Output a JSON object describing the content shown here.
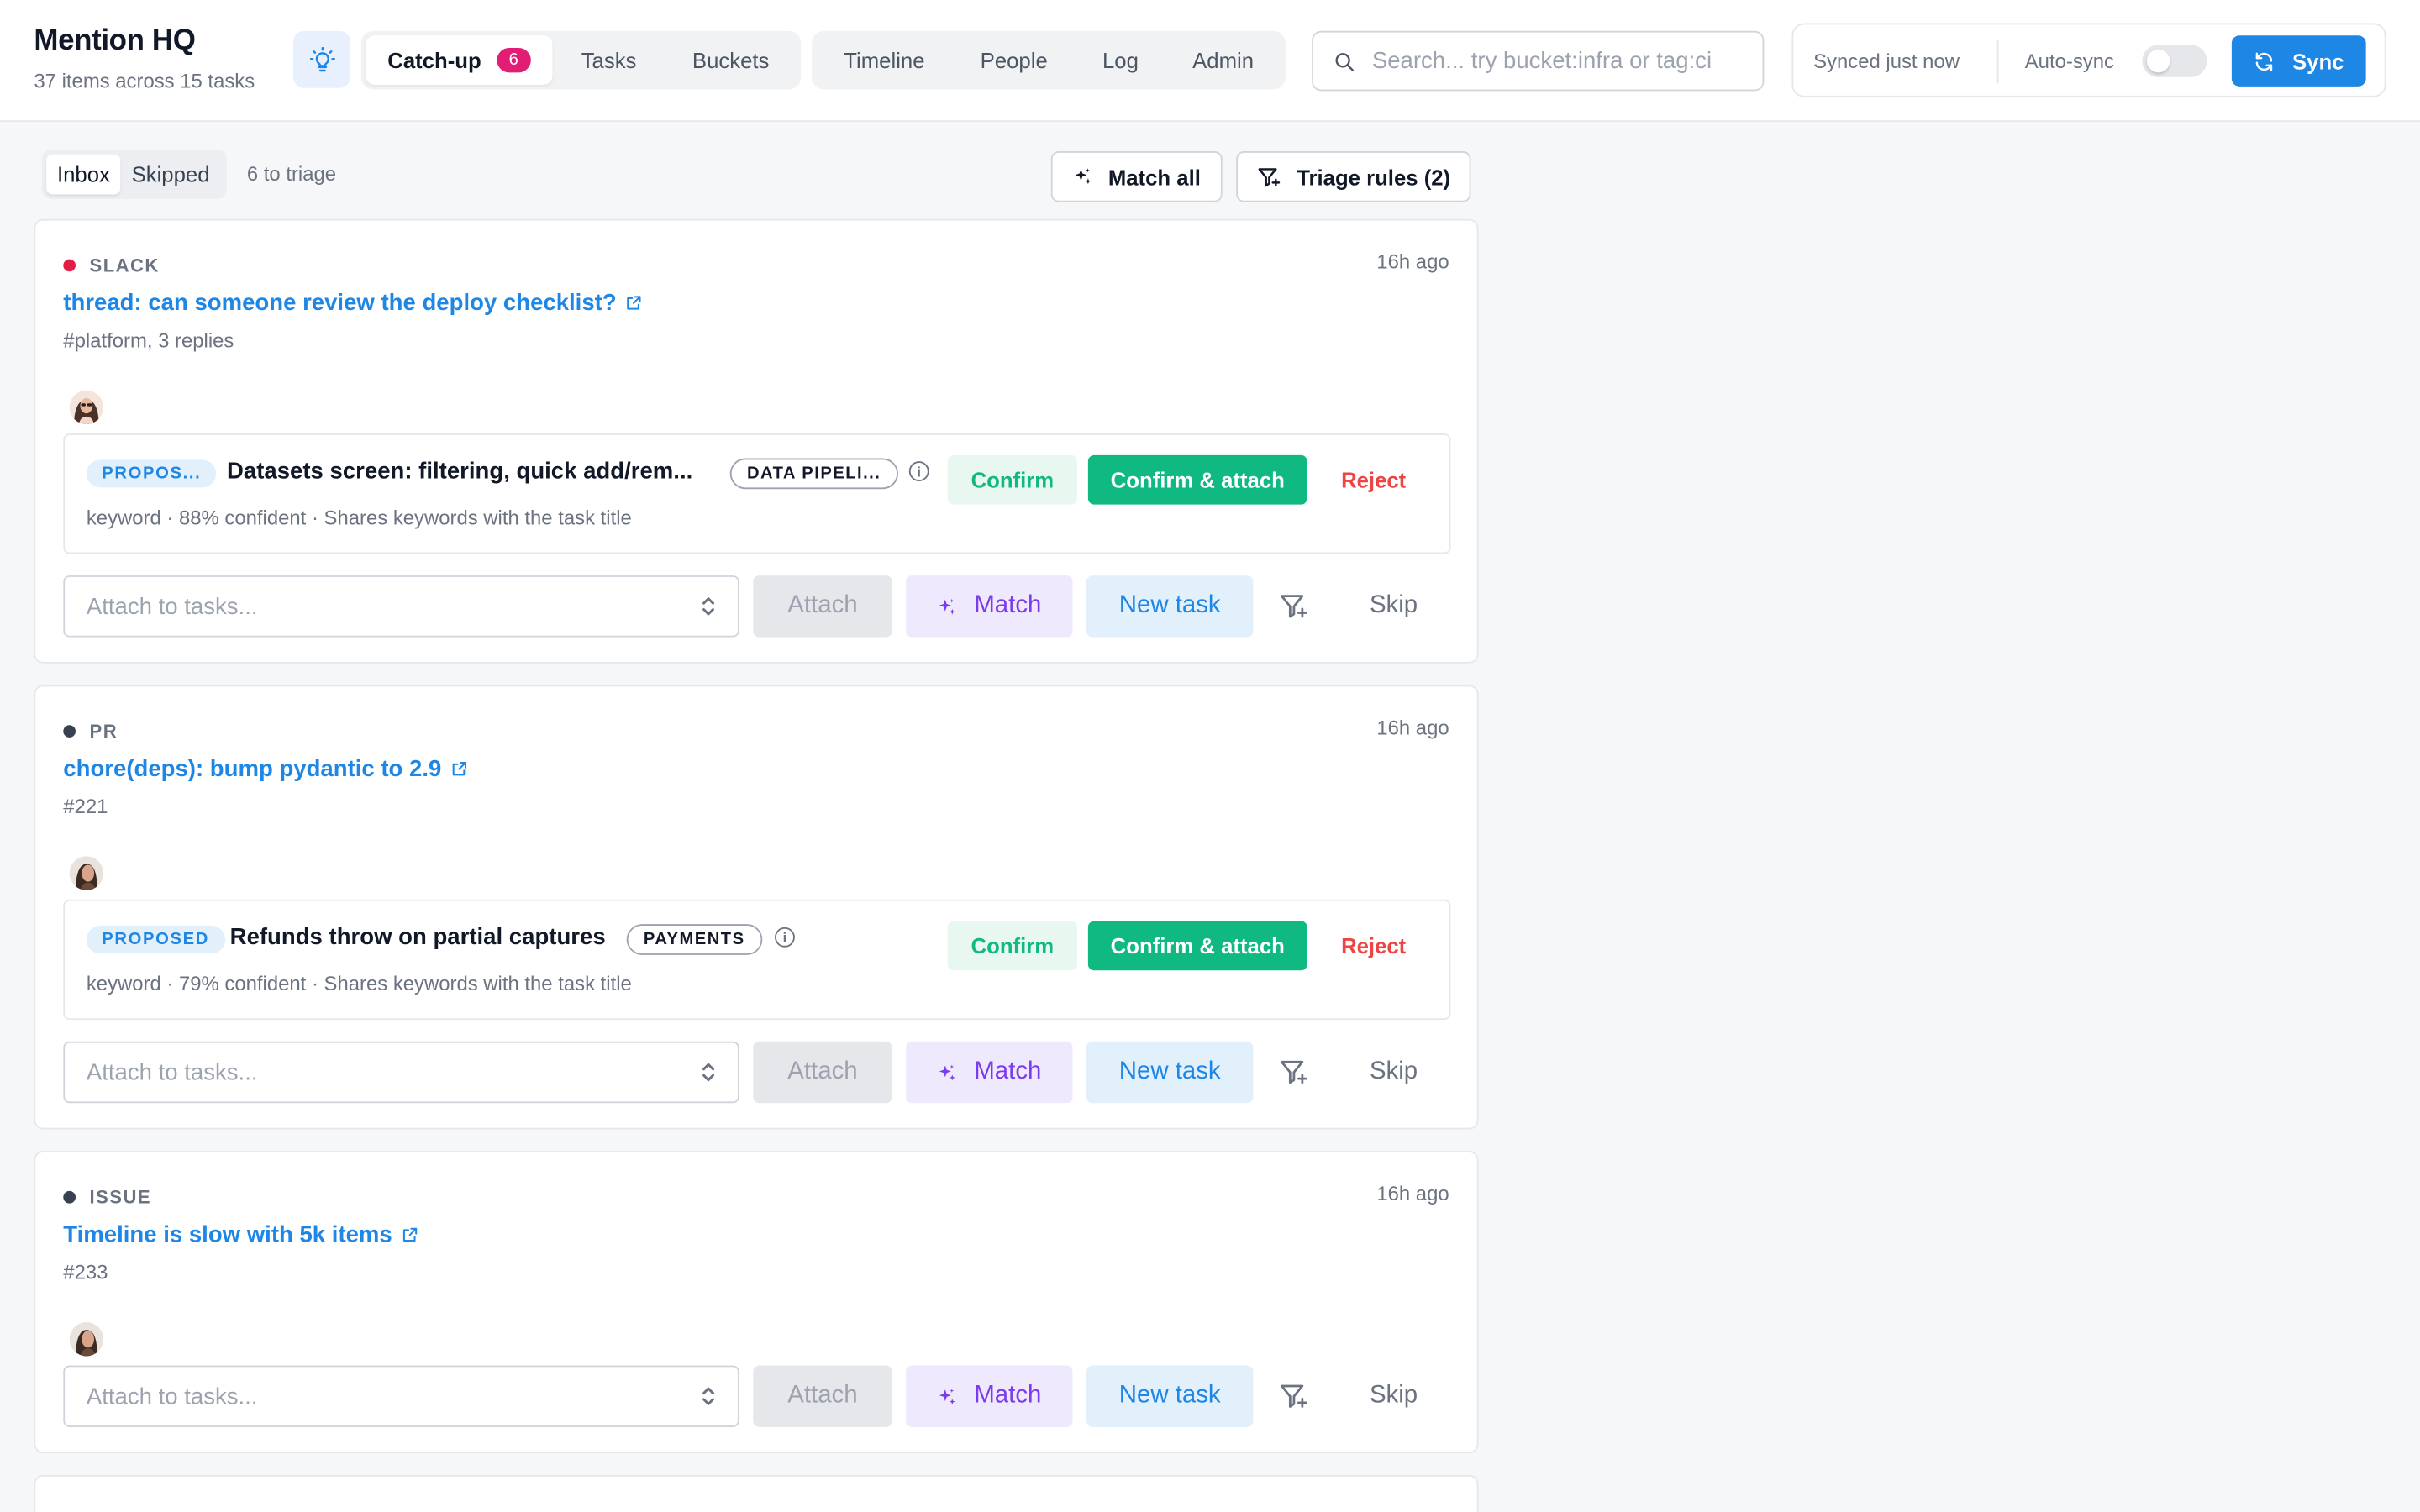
{
  "app": {
    "title": "Mention HQ",
    "subtitle": "37 items across 15 tasks"
  },
  "nav": {
    "group1": [
      {
        "label": "Catch-up",
        "badge": "6",
        "active": true
      },
      {
        "label": "Tasks"
      },
      {
        "label": "Buckets"
      }
    ],
    "group2": [
      {
        "label": "Timeline"
      },
      {
        "label": "People"
      },
      {
        "label": "Log"
      },
      {
        "label": "Admin"
      }
    ]
  },
  "search": {
    "placeholder": "Search... try bucket:infra or tag:ci"
  },
  "sync": {
    "status": "Synced just now",
    "autosync_label": "Auto-sync",
    "autosync_on": false,
    "button_label": "Sync"
  },
  "toolbar": {
    "view_inbox": "Inbox",
    "view_skipped": "Skipped",
    "triage_count": "6 to triage",
    "match_all": "Match all",
    "triage_rules": "Triage rules (2)"
  },
  "colors": {
    "accent": "#1e86e5",
    "confirm": "#10b981",
    "reject": "#ef4444",
    "match": "#7c3aed",
    "slack_dot": "#e11d48",
    "neutral_dot": "#374151"
  },
  "items": [
    {
      "source": "SLACK",
      "age": "16h ago",
      "title": "thread: can someone review the deploy checklist?",
      "subtitle": "#platform, 3 replies",
      "proposal": {
        "badge": "PROPOS...",
        "task": "Datasets screen: filtering, quick add/rem...",
        "tag": "DATA PIPELI...",
        "meta": "keyword · 88% confident · Shares keywords with the task title",
        "confirm": "Confirm",
        "confirm_attach": "Confirm & attach",
        "reject": "Reject"
      },
      "attach_placeholder": "Attach to tasks...",
      "attach": "Attach",
      "match": "Match",
      "new_task": "New task",
      "skip": "Skip"
    },
    {
      "source": "PR",
      "age": "16h ago",
      "title": "chore(deps): bump pydantic to 2.9",
      "subtitle": "#221",
      "proposal": {
        "badge": "PROPOSED",
        "task": "Refunds throw on partial captures",
        "tag": "PAYMENTS",
        "meta": "keyword · 79% confident · Shares keywords with the task title",
        "confirm": "Confirm",
        "confirm_attach": "Confirm & attach",
        "reject": "Reject"
      },
      "attach_placeholder": "Attach to tasks...",
      "attach": "Attach",
      "match": "Match",
      "new_task": "New task",
      "skip": "Skip"
    },
    {
      "source": "ISSUE",
      "age": "16h ago",
      "title": "Timeline is slow with 5k items",
      "subtitle": "#233",
      "attach_placeholder": "Attach to tasks...",
      "attach": "Attach",
      "match": "Match",
      "new_task": "New task",
      "skip": "Skip"
    }
  ]
}
